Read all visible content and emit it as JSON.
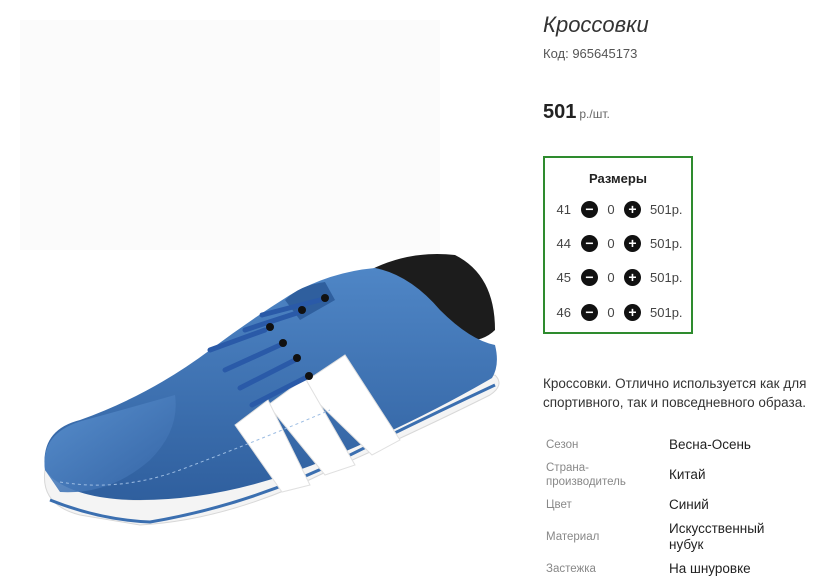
{
  "product": {
    "title": "Кроссовки",
    "code": "Код: 965645173",
    "price_value": "501",
    "price_unit": "р./шт."
  },
  "sizes": {
    "title": "Размеры",
    "rows": [
      {
        "size": "41",
        "qty": "0",
        "price": "501р."
      },
      {
        "size": "44",
        "qty": "0",
        "price": "501р."
      },
      {
        "size": "45",
        "qty": "0",
        "price": "501р."
      },
      {
        "size": "46",
        "qty": "0",
        "price": "501р."
      }
    ],
    "minus_symbol": "−",
    "plus_symbol": "+"
  },
  "description": "Кроссовки. Отлично используется как для спортивного, так и повседневного образа.",
  "properties": [
    {
      "label": "Сезон",
      "value": "Весна-Осень"
    },
    {
      "label": "Страна-производитель",
      "value": "Китай"
    },
    {
      "label": "Цвет",
      "value": "Синий"
    },
    {
      "label": "Материал",
      "value": "Искусственный нубук"
    },
    {
      "label": "Застежка",
      "value": "На шнуровке"
    }
  ],
  "colors": {
    "shoe_blue": "#3b6fb0",
    "frame_green": "#2e8b2e"
  },
  "image": {
    "subject": "blue-sneaker-with-white-stripes"
  }
}
